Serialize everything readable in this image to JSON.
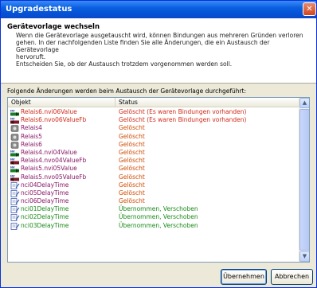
{
  "window": {
    "title": "Upgradestatus",
    "close_glyph": "✕"
  },
  "header": {
    "title": "Gerätevorlage wechseln",
    "desc_lines": [
      "Wenn die Gerätevorlage ausgetauscht wird, können Bindungen aus mehreren Gründen verloren",
      "gehen. In der nachfolgenden Liste finden Sie alle Änderungen, die ein Austausch der Gerätevorlage",
      "hervoruft.",
      "Entscheiden Sie, ob der Austausch trotzdem vorgenommen werden soll."
    ]
  },
  "changes_label": "Folgende Änderungen werden beim Austausch der Gerätevorlage durchgeführt:",
  "list": {
    "columns": [
      "Objekt",
      "Status"
    ],
    "rows": [
      {
        "obj": "Relais6.nvi06Value",
        "status": "Gelöscht (Es waren Bindungen vorhanden)",
        "icon": "nv-input-icon",
        "color": "red"
      },
      {
        "obj": "Relais6.nvo06ValueFb",
        "status": "Gelöscht (Es waren Bindungen vorhanden)",
        "icon": "nv-output-icon",
        "color": "red"
      },
      {
        "obj": "Relais4",
        "status": "Gelöscht",
        "icon": "relay-block-icon",
        "color": "purple"
      },
      {
        "obj": "Relais5",
        "status": "Gelöscht",
        "icon": "relay-block-icon",
        "color": "purple"
      },
      {
        "obj": "Relais6",
        "status": "Gelöscht",
        "icon": "relay-block-icon",
        "color": "purple"
      },
      {
        "obj": "Relais4.nvi04Value",
        "status": "Gelöscht",
        "icon": "nv-input-icon",
        "color": "purple"
      },
      {
        "obj": "Relais4.nvo04ValueFb",
        "status": "Gelöscht",
        "icon": "nv-output-icon",
        "color": "purple"
      },
      {
        "obj": "Relais5.nvi05Value",
        "status": "Gelöscht",
        "icon": "nv-input-icon",
        "color": "purple"
      },
      {
        "obj": "Relais5.nvo05ValueFb",
        "status": "Gelöscht",
        "icon": "nv-output-icon",
        "color": "purple"
      },
      {
        "obj": "nci04DelayTime",
        "status": "Gelöscht",
        "icon": "config-property-icon",
        "color": "purple"
      },
      {
        "obj": "nci05DelayTime",
        "status": "Gelöscht",
        "icon": "config-property-icon",
        "color": "purple"
      },
      {
        "obj": "nci06DelayTime",
        "status": "Gelöscht",
        "icon": "config-property-icon",
        "color": "purple"
      },
      {
        "obj": "nci01DelayTime",
        "status": "Übernommen, Verschoben",
        "icon": "config-property-icon",
        "color": "green"
      },
      {
        "obj": "nci02DelayTime",
        "status": "Übernommen, Verschoben",
        "icon": "config-property-icon",
        "color": "green"
      },
      {
        "obj": "nci03DelayTime",
        "status": "Übernommen, Verschoben",
        "icon": "config-property-icon",
        "color": "green"
      }
    ]
  },
  "buttons": {
    "accept": "Übernehmen",
    "cancel": "Abbrechen"
  },
  "scrollbar": {
    "up_glyph": "▲",
    "down_glyph": "▼"
  },
  "colors": {
    "title_bar": "#0a5fe0",
    "deleted_bound": "#d12b1a",
    "deleted": "#8a1a6a",
    "status_deleted": "#d14a00",
    "kept": "#1a8a1a"
  }
}
